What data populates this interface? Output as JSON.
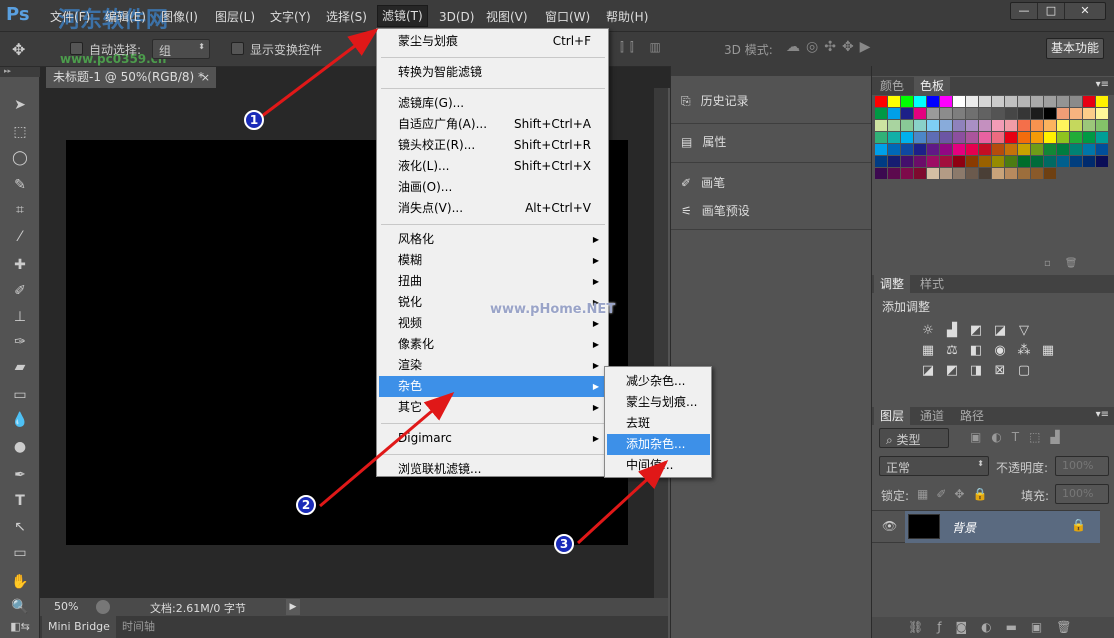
{
  "app": {
    "logo": "Ps",
    "watermark_cn": "河东软件网",
    "watermark_url": "www.pc0359.cn",
    "canvas_watermark": "www.pHome.NET"
  },
  "menubar": {
    "items": [
      "文件(F)",
      "编辑(E)",
      "图像(I)",
      "图层(L)",
      "文字(Y)",
      "选择(S)",
      "滤镜(T)",
      "3D(D)",
      "视图(V)",
      "窗口(W)",
      "帮助(H)"
    ],
    "active": "滤镜(T)"
  },
  "window_controls": {
    "minimize": "—",
    "maximize": "□",
    "close": "✕"
  },
  "options": {
    "auto_select_label": "自动选择:",
    "auto_select_value": "组",
    "show_transform_label": "显示变换控件",
    "mode_3d_label": "3D 模式:",
    "workspace": "基本功能"
  },
  "document": {
    "tab_title": "未标题-1 @ 50%(RGB/8) *",
    "close": "×"
  },
  "status": {
    "zoom": "50%",
    "doc_info": "文档:2.61M/0 字节"
  },
  "bottom_tabs": [
    "Mini Bridge",
    "时间轴"
  ],
  "mid_panel": {
    "items": [
      "历史记录",
      "属性",
      "画笔",
      "画笔预设"
    ]
  },
  "swatch_panel": {
    "tabs": [
      "颜色",
      "色板"
    ],
    "active": "色板",
    "colors": [
      "#ff0000",
      "#ffff00",
      "#00ff00",
      "#00ffff",
      "#0000ff",
      "#ff00ff",
      "#ffffff",
      "#ebebeb",
      "#d6d6d6",
      "#cbcbcb",
      "#c0c0c0",
      "#b5b5b5",
      "#aaaaaa",
      "#9f9f9f",
      "#949494",
      "#8a8a8a",
      "#e60012",
      "#fff100",
      "#009944",
      "#00a0e9",
      "#1d2088",
      "#e4007f",
      "#9a9a9a",
      "#8c8c8c",
      "#7e7e7e",
      "#707070",
      "#626262",
      "#545454",
      "#464646",
      "#363636",
      "#1c1c1c",
      "#000000",
      "#f19d76",
      "#f7b37f",
      "#fccd89",
      "#fff799",
      "#cde3a1",
      "#a9d4a0",
      "#89c997",
      "#89d1c9",
      "#7ecef4",
      "#88abda",
      "#8f82bc",
      "#a98fc5",
      "#c490bf",
      "#f29cb6",
      "#f19ca7",
      "#f46f4a",
      "#f8934f",
      "#fcb35e",
      "#fff45c",
      "#c5d85d",
      "#9cc77a",
      "#84c269",
      "#31b178",
      "#12afa8",
      "#00b0ec",
      "#4c87c8",
      "#5e6db5",
      "#6c56a4",
      "#8c4f9f",
      "#aa559c",
      "#e862a1",
      "#ed6b80",
      "#e60012",
      "#f36c0c",
      "#f59b07",
      "#fff100",
      "#8fc31f",
      "#22ac38",
      "#009944",
      "#009e96",
      "#00a0e9",
      "#0068b7",
      "#0f48a1",
      "#1d2088",
      "#601986",
      "#920783",
      "#e4007f",
      "#e5004f",
      "#c30d23",
      "#b54c0d",
      "#c5720a",
      "#c8a200",
      "#6f9c18",
      "#128736",
      "#007c3f",
      "#008274",
      "#0076a9",
      "#014f9b",
      "#003c84",
      "#161d71",
      "#440f6c",
      "#6b0d69",
      "#9d0d64",
      "#a20e3d",
      "#8e0012",
      "#8a3b00",
      "#996100",
      "#968b00",
      "#4c7c12",
      "#006d2b",
      "#006b3a",
      "#006a63",
      "#005f8d",
      "#003e7e",
      "#002b6d",
      "#0a0e57",
      "#3c0a50",
      "#5c0a4e",
      "#7e0a4a",
      "#7e0a2e",
      "#d4bfa3",
      "#b39b85",
      "#8c7a6b",
      "#6b5a4d",
      "#4a3f36",
      "#c9a37a",
      "#b88a5e",
      "#9c6e3c",
      "#8a5a2a",
      "#6e4012"
    ]
  },
  "adjustments": {
    "tabs": [
      "调整",
      "样式"
    ],
    "active": "调整",
    "title": "添加调整",
    "icons": [
      "brightness-icon",
      "levels-icon",
      "curves-icon",
      "exposure-icon",
      "vibrance-icon",
      "hue-saturation-icon",
      "color-balance-icon",
      "black-white-icon",
      "photo-filter-icon",
      "channel-mixer-icon",
      "color-lookup-icon",
      "invert-icon",
      "posterize-icon",
      "threshold-icon",
      "gradient-map-icon",
      "selective-color-icon"
    ]
  },
  "layers": {
    "tabs": [
      "图层",
      "通道",
      "路径"
    ],
    "active": "图层",
    "filter_type": "类型",
    "blend_mode": "正常",
    "opacity_label": "不透明度:",
    "opacity_value": "100%",
    "lock_label": "锁定:",
    "fill_label": "填充:",
    "fill_value": "100%",
    "layer": {
      "name": "背景",
      "visible": true,
      "locked": true,
      "thumb_color": "#000000"
    }
  },
  "filter_menu": {
    "items": [
      {
        "label": "蒙尘与划痕",
        "shortcut": "Ctrl+F"
      },
      {
        "sep": true
      },
      {
        "label": "转换为智能滤镜"
      },
      {
        "sep": true
      },
      {
        "label": "滤镜库(G)..."
      },
      {
        "label": "自适应广角(A)...",
        "shortcut": "Shift+Ctrl+A"
      },
      {
        "label": "镜头校正(R)...",
        "shortcut": "Shift+Ctrl+R"
      },
      {
        "label": "液化(L)...",
        "shortcut": "Shift+Ctrl+X"
      },
      {
        "label": "油画(O)..."
      },
      {
        "label": "消失点(V)...",
        "shortcut": "Alt+Ctrl+V"
      },
      {
        "sep": true
      },
      {
        "label": "风格化",
        "submenu": true
      },
      {
        "label": "模糊",
        "submenu": true
      },
      {
        "label": "扭曲",
        "submenu": true
      },
      {
        "label": "锐化",
        "submenu": true
      },
      {
        "label": "视频",
        "submenu": true
      },
      {
        "label": "像素化",
        "submenu": true
      },
      {
        "label": "渲染",
        "submenu": true
      },
      {
        "label": "杂色",
        "submenu": true,
        "highlighted": true
      },
      {
        "label": "其它",
        "submenu": true
      },
      {
        "sep": true
      },
      {
        "label": "Digimarc",
        "submenu": true
      },
      {
        "sep": true
      },
      {
        "label": "浏览联机滤镜..."
      }
    ]
  },
  "noise_submenu": {
    "items": [
      "减少杂色...",
      "蒙尘与划痕...",
      "去斑",
      "添加杂色...",
      "中间值..."
    ],
    "highlighted": "添加杂色..."
  },
  "annotations": {
    "badges": [
      "1",
      "2",
      "3"
    ],
    "arrow_color": "#e01818",
    "badge_color": "#1a2bb8"
  },
  "colors": {
    "menu_highlight": "#3d90e8",
    "ui_dark": "#3c3c3c",
    "ui_panel": "#535353",
    "layer_selected": "#5a6a80"
  }
}
